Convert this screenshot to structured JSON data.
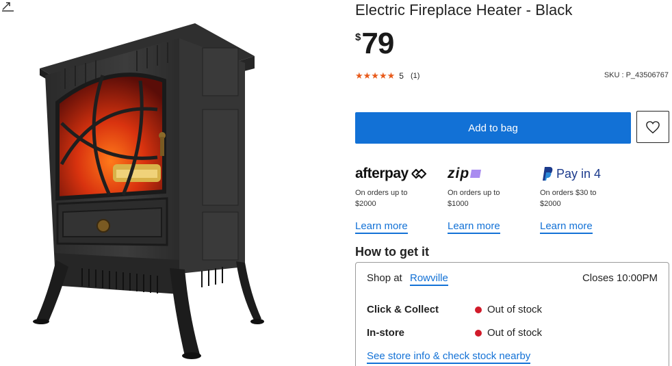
{
  "product": {
    "title": "Electric Fireplace Heater - Black",
    "currency_symbol": "$",
    "price": "79",
    "rating": {
      "stars": "★★★★★",
      "score": "5",
      "count": "(1)",
      "value": 5
    },
    "sku": "SKU : P_43506767",
    "image_icon": "fireplace-heater-image"
  },
  "actions": {
    "add_to_bag": "Add to bag",
    "wishlist_icon": "heart-icon",
    "expand_icon": "expand-icon"
  },
  "payments": [
    {
      "brand": "afterpay",
      "icon": "afterpay-loop-icon",
      "desc_line1": "On orders up to",
      "desc_line2": "$2000",
      "learn": "Learn more"
    },
    {
      "brand": "zip",
      "icon": "zip-logo",
      "desc_line1": "On orders up to",
      "desc_line2": "$1000",
      "learn": "Learn more"
    },
    {
      "brand": "Pay in 4",
      "icon": "paypal-icon",
      "desc_line1": "On orders $30 to",
      "desc_line2": "$2000",
      "learn": "Learn more"
    }
  ],
  "fulfilment": {
    "heading": "How to get it",
    "shop_at": "Shop at",
    "store": "Rowville",
    "closes": "Closes 10:00PM",
    "rows": [
      {
        "label": "Click & Collect",
        "status": "Out of stock",
        "status_color": "#d11b2a"
      },
      {
        "label": "In-store",
        "status": "Out of stock",
        "status_color": "#d11b2a"
      }
    ],
    "store_info_link": "See store info & check stock nearby"
  },
  "colors": {
    "accent": "#1271d6",
    "star": "#e85a1a",
    "out_of_stock": "#d11b2a"
  }
}
